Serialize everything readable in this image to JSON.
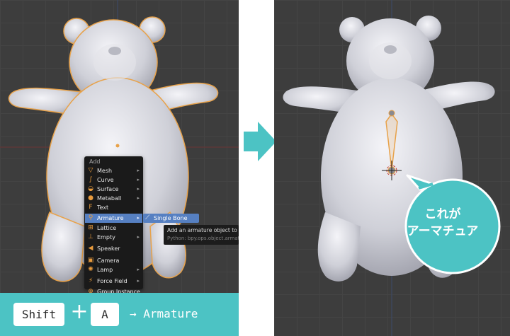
{
  "left_viewport": {
    "add_menu": {
      "title": "Add",
      "items": [
        {
          "label": "Mesh",
          "icon": "mesh-icon",
          "glyph": "▽",
          "submenu": true
        },
        {
          "label": "Curve",
          "icon": "curve-icon",
          "glyph": "∫",
          "submenu": true
        },
        {
          "label": "Surface",
          "icon": "surface-icon",
          "glyph": "◒",
          "submenu": true
        },
        {
          "label": "Metaball",
          "icon": "metaball-icon",
          "glyph": "●",
          "submenu": true
        },
        {
          "label": "Text",
          "icon": "text-icon",
          "glyph": "F",
          "submenu": false
        },
        {
          "label": "Armature",
          "icon": "armature-icon",
          "glyph": "⚲",
          "submenu": true,
          "active": true
        },
        {
          "label": "Lattice",
          "icon": "lattice-icon",
          "glyph": "⊞",
          "submenu": false
        },
        {
          "label": "Empty",
          "icon": "empty-icon",
          "glyph": "⊥",
          "submenu": true
        },
        {
          "label": "Speaker",
          "icon": "speaker-icon",
          "glyph": "◀",
          "submenu": false
        },
        {
          "label": "Camera",
          "icon": "camera-icon",
          "glyph": "▣",
          "submenu": false
        },
        {
          "label": "Lamp",
          "icon": "lamp-icon",
          "glyph": "✺",
          "submenu": true
        },
        {
          "label": "Force Field",
          "icon": "force-field-icon",
          "glyph": "⚡",
          "submenu": true
        },
        {
          "label": "Group Instance",
          "icon": "group-instance-icon",
          "glyph": "⊕",
          "submenu": true
        }
      ]
    },
    "submenu": {
      "label": "Single Bone",
      "icon": "bone-icon"
    },
    "tooltip": {
      "description": "Add an armature object to the",
      "python": "Python: bpy.ops.object.armatu"
    }
  },
  "shortcut_banner": {
    "key1": "Shift",
    "plus": "+",
    "key2": "A",
    "arrow": "→",
    "result": "Armature"
  },
  "callout": {
    "line1": "これが",
    "line2": "アーマチュア"
  },
  "colors": {
    "viewport_bg": "#3d3d3d",
    "menu_bg": "#1a1a1a",
    "menu_highlight": "#5680c2",
    "accent_teal": "#4cc3c4",
    "bone_orange": "#e8a24a"
  }
}
